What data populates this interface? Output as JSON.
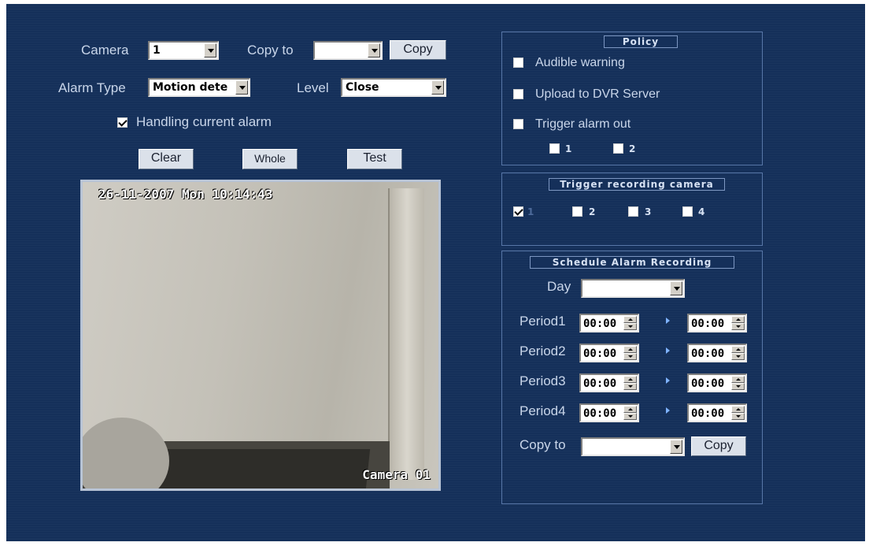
{
  "form": {
    "camera_label": "Camera",
    "camera_value": "1",
    "copy_to_label": "Copy to",
    "copy_to_value": "",
    "copy_button": "Copy",
    "alarm_type_label": "Alarm Type",
    "alarm_type_value": "Motion dete",
    "level_label": "Level",
    "level_value": "Close",
    "handling_label": "Handling current alarm",
    "handling_checked": true,
    "clear_button": "Clear",
    "whole_button": "Whole",
    "test_button": "Test"
  },
  "video": {
    "timestamp": "26-11-2007 Mon 10:14:43",
    "camera_name": "Camera 01"
  },
  "policy": {
    "title": "Policy",
    "options": [
      {
        "label": "Audible warning",
        "checked": false
      },
      {
        "label": "Upload to DVR Server",
        "checked": false
      },
      {
        "label": "Trigger alarm out",
        "checked": false
      }
    ],
    "alarm_outs": [
      {
        "label": "1",
        "checked": false
      },
      {
        "label": "2",
        "checked": false
      }
    ]
  },
  "trigger": {
    "title": "Trigger recording camera",
    "cameras": [
      {
        "label": "1",
        "checked": true
      },
      {
        "label": "2",
        "checked": false
      },
      {
        "label": "3",
        "checked": false
      },
      {
        "label": "4",
        "checked": false
      }
    ]
  },
  "schedule": {
    "title": "Schedule Alarm Recording",
    "day_label": "Day",
    "day_value": "",
    "periods": [
      {
        "label": "Period1",
        "start": "00:00",
        "end": "00:00"
      },
      {
        "label": "Period2",
        "start": "00:00",
        "end": "00:00"
      },
      {
        "label": "Period3",
        "start": "00:00",
        "end": "00:00"
      },
      {
        "label": "Period4",
        "start": "00:00",
        "end": "00:00"
      }
    ],
    "copy_to_label": "Copy to",
    "copy_to_value": "",
    "copy_button": "Copy"
  }
}
